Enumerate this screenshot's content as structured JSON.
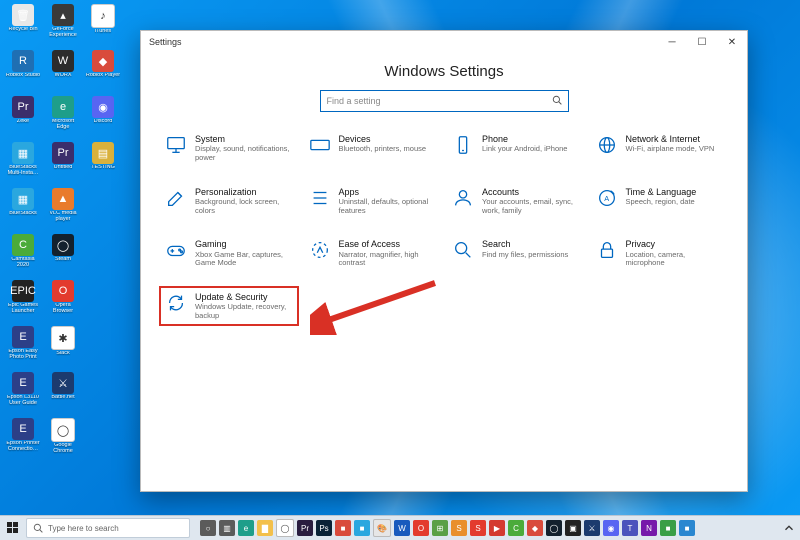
{
  "desktop_icons": [
    {
      "label": "Recycle Bin",
      "color": "#e8e8e8",
      "glyph": "🗑"
    },
    {
      "label": "GeForce Experience",
      "color": "#3a3a3a",
      "glyph": "▴"
    },
    {
      "label": "iTunes",
      "color": "#fff",
      "glyph": "♪"
    },
    {
      "label": "Roblox Studio",
      "color": "#1f6fb3",
      "glyph": "R"
    },
    {
      "label": "WORX",
      "color": "#2c2c2c",
      "glyph": "W"
    },
    {
      "label": "Roblox Player",
      "color": "#d94b3c",
      "glyph": "◆"
    },
    {
      "label": "Zeke",
      "color": "#3b2e6b",
      "glyph": "Pr"
    },
    {
      "label": "Microsoft Edge",
      "color": "#1e9e8a",
      "glyph": "e"
    },
    {
      "label": "Discord",
      "color": "#5865f2",
      "glyph": "◉"
    },
    {
      "label": "BlueStacks Multi-Insta…",
      "color": "#2aa7df",
      "glyph": "▦"
    },
    {
      "label": "Untitled",
      "color": "#3b2e6b",
      "glyph": "Pr"
    },
    {
      "label": "TESTING",
      "color": "#d9b13c",
      "glyph": "▤"
    },
    {
      "label": "BlueStacks",
      "color": "#2aa7df",
      "glyph": "▦"
    },
    {
      "label": "VLC media player",
      "color": "#e97b2c",
      "glyph": "▲"
    },
    {
      "label": "",
      "color": "transparent",
      "glyph": ""
    },
    {
      "label": "Camtasia 2020",
      "color": "#4bab3a",
      "glyph": "C"
    },
    {
      "label": "Steam",
      "color": "#13212e",
      "glyph": "◯"
    },
    {
      "label": "",
      "color": "transparent",
      "glyph": ""
    },
    {
      "label": "Epic Games Launcher",
      "color": "#222",
      "glyph": "EPIC"
    },
    {
      "label": "Opera Browser",
      "color": "#e33b2e",
      "glyph": "O"
    },
    {
      "label": "",
      "color": "transparent",
      "glyph": ""
    },
    {
      "label": "Epson Easy Photo Print",
      "color": "#2c3f88",
      "glyph": "E"
    },
    {
      "label": "Slack",
      "color": "#fff",
      "glyph": "✱"
    },
    {
      "label": "",
      "color": "transparent",
      "glyph": ""
    },
    {
      "label": "Epson L3110 User Guide",
      "color": "#2c3f88",
      "glyph": "E"
    },
    {
      "label": "Battle.net",
      "color": "#1c3b6e",
      "glyph": "⚔"
    },
    {
      "label": "",
      "color": "transparent",
      "glyph": ""
    },
    {
      "label": "Epson Printer Connectio…",
      "color": "#2c3f88",
      "glyph": "E"
    },
    {
      "label": "Google Chrome",
      "color": "#fff",
      "glyph": "◯"
    },
    {
      "label": "",
      "color": "transparent",
      "glyph": ""
    }
  ],
  "settings": {
    "title": "Settings",
    "heading": "Windows Settings",
    "search_placeholder": "Find a setting",
    "tiles": [
      {
        "id": "system",
        "title": "System",
        "sub": "Display, sound, notifications, power",
        "icon": "monitor"
      },
      {
        "id": "devices",
        "title": "Devices",
        "sub": "Bluetooth, printers, mouse",
        "icon": "keyboard"
      },
      {
        "id": "phone",
        "title": "Phone",
        "sub": "Link your Android, iPhone",
        "icon": "phone"
      },
      {
        "id": "network",
        "title": "Network & Internet",
        "sub": "Wi-Fi, airplane mode, VPN",
        "icon": "globe"
      },
      {
        "id": "personalization",
        "title": "Personalization",
        "sub": "Background, lock screen, colors",
        "icon": "brush"
      },
      {
        "id": "apps",
        "title": "Apps",
        "sub": "Uninstall, defaults, optional features",
        "icon": "apps"
      },
      {
        "id": "accounts",
        "title": "Accounts",
        "sub": "Your accounts, email, sync, work, family",
        "icon": "person"
      },
      {
        "id": "time",
        "title": "Time & Language",
        "sub": "Speech, region, date",
        "icon": "time"
      },
      {
        "id": "gaming",
        "title": "Gaming",
        "sub": "Xbox Game Bar, captures, Game Mode",
        "icon": "game"
      },
      {
        "id": "ease",
        "title": "Ease of Access",
        "sub": "Narrator, magnifier, high contrast",
        "icon": "ease"
      },
      {
        "id": "search",
        "title": "Search",
        "sub": "Find my files, permissions",
        "icon": "search"
      },
      {
        "id": "privacy",
        "title": "Privacy",
        "sub": "Location, camera, microphone",
        "icon": "lock"
      },
      {
        "id": "update",
        "title": "Update & Security",
        "sub": "Windows Update, recovery, backup",
        "icon": "update",
        "highlight": true
      }
    ]
  },
  "taskbar": {
    "search_placeholder": "Type here to search",
    "pins": [
      {
        "name": "cortana",
        "color": "#5b5b5b",
        "glyph": "○"
      },
      {
        "name": "task-view",
        "color": "#5b5b5b",
        "glyph": "▥"
      },
      {
        "name": "edge",
        "color": "#1e9e8a",
        "glyph": "e"
      },
      {
        "name": "explorer",
        "color": "#f3c04b",
        "glyph": "▇"
      },
      {
        "name": "chrome",
        "color": "#ffffff",
        "glyph": "◯"
      },
      {
        "name": "premiere",
        "color": "#2a1d3f",
        "glyph": "Pr"
      },
      {
        "name": "photoshop",
        "color": "#0a2236",
        "glyph": "Ps"
      },
      {
        "name": "app1",
        "color": "#d94b3c",
        "glyph": "■"
      },
      {
        "name": "app2",
        "color": "#2aa7df",
        "glyph": "■"
      },
      {
        "name": "paint",
        "color": "#e6e6e6",
        "glyph": "🎨"
      },
      {
        "name": "word",
        "color": "#185abd",
        "glyph": "W"
      },
      {
        "name": "office",
        "color": "#e33b2e",
        "glyph": "O"
      },
      {
        "name": "calc",
        "color": "#5ba046",
        "glyph": "⊞"
      },
      {
        "name": "snagit",
        "color": "#e98f2c",
        "glyph": "S"
      },
      {
        "name": "snagit-ed",
        "color": "#e33b2e",
        "glyph": "S"
      },
      {
        "name": "anydesk",
        "color": "#d43a2f",
        "glyph": "▶"
      },
      {
        "name": "camtasia",
        "color": "#4bab3a",
        "glyph": "C"
      },
      {
        "name": "roblox",
        "color": "#d94b3c",
        "glyph": "◆"
      },
      {
        "name": "steam",
        "color": "#13212e",
        "glyph": "◯"
      },
      {
        "name": "epic",
        "color": "#222",
        "glyph": "▣"
      },
      {
        "name": "battlenet",
        "color": "#1c3b6e",
        "glyph": "⚔"
      },
      {
        "name": "discord",
        "color": "#5865f2",
        "glyph": "◉"
      },
      {
        "name": "teams",
        "color": "#4b53bc",
        "glyph": "T"
      },
      {
        "name": "onenote",
        "color": "#7719aa",
        "glyph": "N"
      },
      {
        "name": "app3",
        "color": "#3a9e46",
        "glyph": "■"
      },
      {
        "name": "app4",
        "color": "#2a87d0",
        "glyph": "■"
      }
    ]
  },
  "colors": {
    "accent": "#0067c0",
    "highlight": "#d93025"
  }
}
